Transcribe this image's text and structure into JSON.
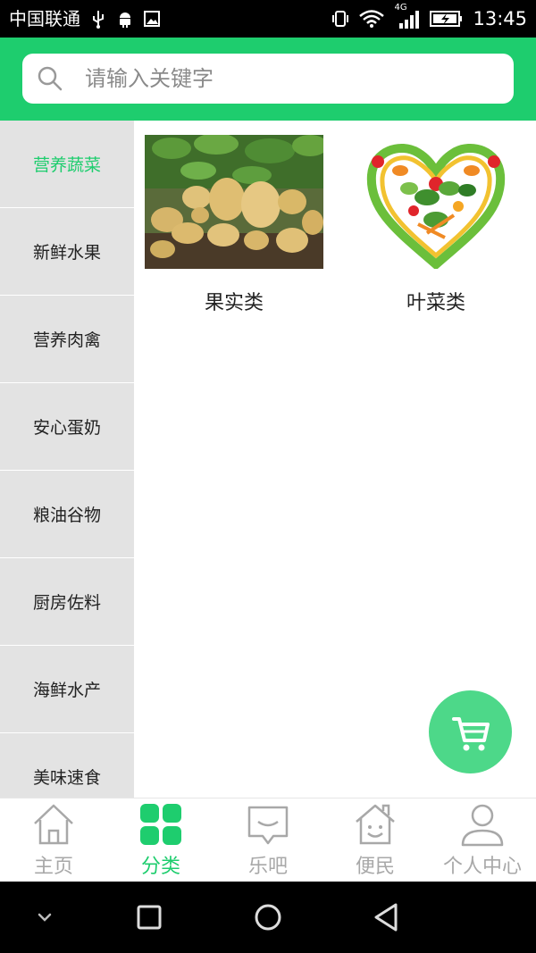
{
  "status_bar": {
    "carrier": "中国联通",
    "network": "4G",
    "time": "13:45"
  },
  "search": {
    "placeholder": "请输入关键字",
    "value": ""
  },
  "sidebar": {
    "items": [
      {
        "label": "营养蔬菜",
        "active": true
      },
      {
        "label": "新鲜水果",
        "active": false
      },
      {
        "label": "营养肉禽",
        "active": false
      },
      {
        "label": "安心蛋奶",
        "active": false
      },
      {
        "label": "粮油谷物",
        "active": false
      },
      {
        "label": "厨房佐料",
        "active": false
      },
      {
        "label": "海鲜水产",
        "active": false
      },
      {
        "label": "美味速食",
        "active": false
      }
    ]
  },
  "categories": [
    {
      "label": "果实类",
      "image": "potatoes-photo"
    },
    {
      "label": "叶菜类",
      "image": "vegetable-heart-photo"
    }
  ],
  "tabbar": {
    "items": [
      {
        "label": "主页",
        "icon": "home-icon",
        "active": false
      },
      {
        "label": "分类",
        "icon": "category-grid-icon",
        "active": true
      },
      {
        "label": "乐吧",
        "icon": "chat-bubble-icon",
        "active": false
      },
      {
        "label": "便民",
        "icon": "house-smile-icon",
        "active": false
      },
      {
        "label": "个人中心",
        "icon": "user-icon",
        "active": false
      }
    ]
  },
  "colors": {
    "accent": "#1ecd6e",
    "sidebar_bg": "#e3e3e3",
    "fab": "#4dd889",
    "inactive_tab": "#a8a8a8"
  }
}
